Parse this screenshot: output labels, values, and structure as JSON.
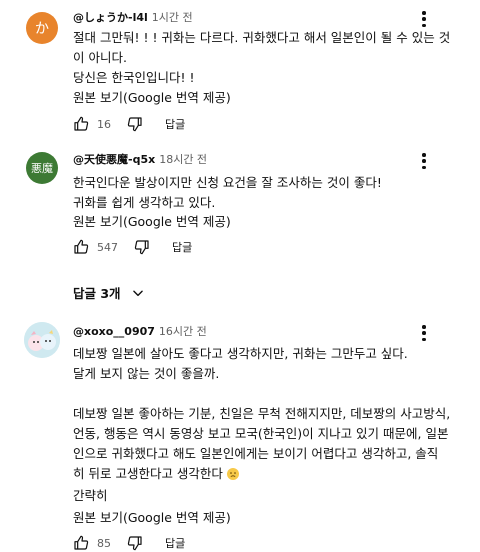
{
  "comments": [
    {
      "avatar_text": "か",
      "avatar_color": "#e8842c",
      "handle": "@しょうか-l4l",
      "time": "1시간 전",
      "lines": [
        "절대 그만둬! ! ! 귀화는 다르다. 귀화했다고 해서 일본인이 될 수 있는 것",
        "이 아니다.",
        "당신은 한국인입니다! !"
      ],
      "translate_label": "원본 보기(Google 번역 제공)",
      "likes": "16",
      "reply_label": "답글"
    },
    {
      "avatar_text": "悪魔",
      "avatar_color": "#3d7a34",
      "handle": "@天使悪魔-q5x",
      "time": "18시간 전",
      "lines": [
        "한국인다운 발상이지만 신청 요건을 잘 조사하는 것이 좋다!",
        "귀화를 쉽게 생각하고 있다."
      ],
      "translate_label": "원본 보기(Google 번역 제공)",
      "likes": "547",
      "reply_label": "답글",
      "replies_toggle": "답글 3개"
    },
    {
      "avatar_color": "#d8eef2",
      "handle": "@xoxo__0907",
      "time": "16시간 전",
      "lines": [
        "데보짱 일본에 살아도 좋다고 생각하지만, 귀화는 그만두고 싶다.",
        "달게 보지 않는 것이 좋을까.",
        "",
        "데보짱 일본 좋아하는 기분, 친일은 무척 전해지지만, 데보짱의 사고방식,",
        "언동, 행동은 역시 동영상 보고 모국(한국인)이 지나고 있기 때문에, 일본",
        "인으로 귀화했다고 해도 일본인에게는 보이기 어렵다고 생각하고, 솔직",
        "히 뒤로 고생한다고 생각한다"
      ],
      "collapse_label": "간략히",
      "translate_label": "원본 보기(Google 번역 제공)",
      "likes": "85",
      "reply_label": "답글"
    }
  ]
}
